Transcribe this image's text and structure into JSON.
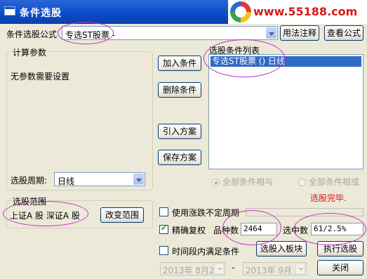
{
  "window": {
    "title": "条件选股"
  },
  "watermark": {
    "url": "www.55188.com"
  },
  "formula": {
    "label": "条件选股公式",
    "value": "专选ST股票 -"
  },
  "buttons": {
    "usage_notes": "用法注释",
    "view_formula": "查看公式",
    "add_condition": "加入条件",
    "delete_condition": "删除条件",
    "import_plan": "引入方案",
    "save_plan": "保存方案",
    "change_range": "改变范围",
    "to_board": "选股入板块",
    "execute": "执行选股",
    "close": "关闭"
  },
  "params": {
    "title": "计算参数",
    "message": "无参数需要设置"
  },
  "period": {
    "label": "选股周期:",
    "value": "日线"
  },
  "condition_list": {
    "title": "选股条件列表",
    "items": [
      "专选ST股票  ()  日线"
    ]
  },
  "logic": {
    "all_and": "全部条件相与",
    "all_or": "全部条件相或",
    "selected": "all_and"
  },
  "status": {
    "text": "选股完毕.",
    "color": "#e01616"
  },
  "range": {
    "title": "选股范围",
    "value": "上证A 股 深证A 股"
  },
  "options": {
    "variable_period": {
      "label": "使用涨跌不定周期",
      "checked": false
    },
    "precise_restore": {
      "label": "精确复权",
      "checked": true
    },
    "date_range": {
      "label": "时间段内满足条件",
      "checked": false
    }
  },
  "stats": {
    "count_label": "品种数",
    "count_value": "2464",
    "selected_label": "选中数",
    "selected_value": "61/2.5%"
  },
  "dates": {
    "from": "2013年 8月2",
    "dash": "-",
    "to": "2013年 9月"
  }
}
